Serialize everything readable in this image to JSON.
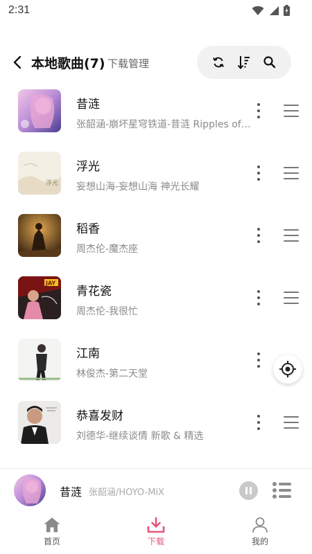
{
  "status_bar": {
    "time": "2:31",
    "icons": [
      "wifi-icon",
      "signal-icon",
      "battery-icon"
    ]
  },
  "header": {
    "title": "本地歌曲(7)",
    "manage_label": "下载管理",
    "toolbar_icons": [
      "refresh-icon",
      "sort-icon",
      "search-icon"
    ]
  },
  "songs": [
    {
      "title": "昔涟",
      "subtitle": "张韶涵-崩坏星穹铁道-昔涟 Ripples of Past Reverie"
    },
    {
      "title": "浮光",
      "subtitle": "妄想山海-妄想山海 神光长耀"
    },
    {
      "title": "稻香",
      "subtitle": "周杰伦-魔杰座"
    },
    {
      "title": "青花瓷",
      "subtitle": "周杰伦-我很忙"
    },
    {
      "title": "江南",
      "subtitle": "林俊杰-第二天堂"
    },
    {
      "title": "恭喜发财",
      "subtitle": "刘德华-继续谈情 新歌 & 精选"
    }
  ],
  "cover_texts": {
    "song2": "浮光",
    "song4": "JAY"
  },
  "now_playing": {
    "title": "昔涟",
    "artist": "张韶涵/HOYO-MiX"
  },
  "nav": {
    "items": [
      {
        "label": "首页",
        "icon": "home-icon"
      },
      {
        "label": "下载",
        "icon": "download-icon",
        "active": true
      },
      {
        "label": "我的",
        "icon": "profile-icon"
      }
    ]
  },
  "colors": {
    "accent": "#e5557a",
    "text": "#111111",
    "secondary": "#8a8a8a"
  }
}
